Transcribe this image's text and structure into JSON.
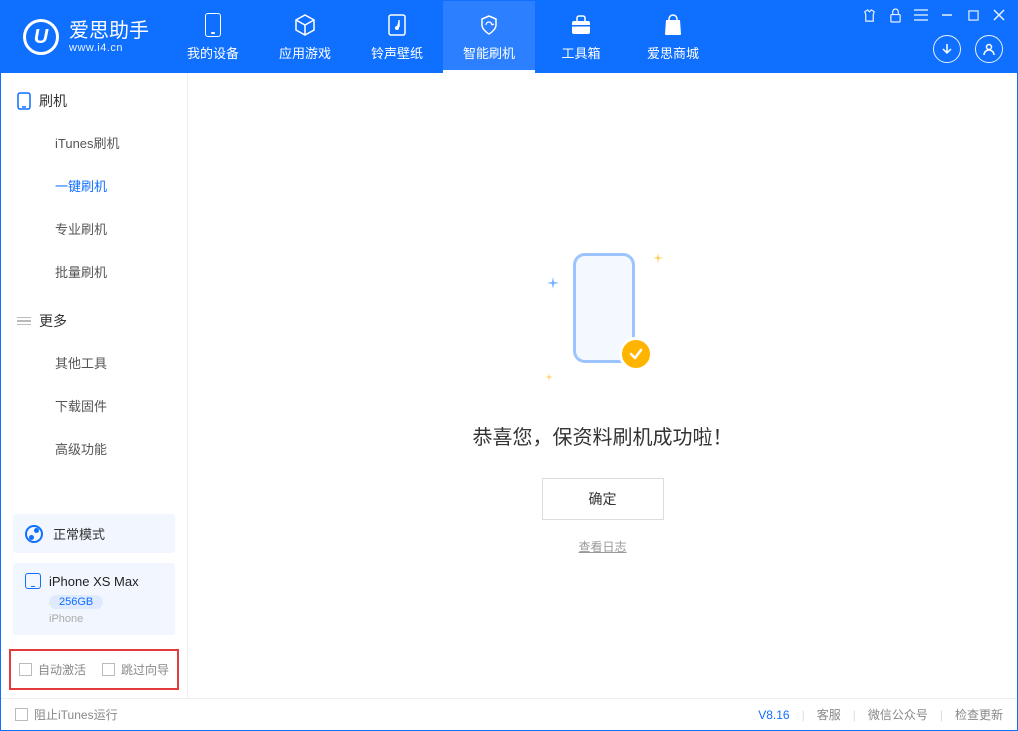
{
  "app": {
    "name": "爱思助手",
    "url": "www.i4.cn"
  },
  "nav": {
    "items": [
      {
        "label": "我的设备"
      },
      {
        "label": "应用游戏"
      },
      {
        "label": "铃声壁纸"
      },
      {
        "label": "智能刷机"
      },
      {
        "label": "工具箱"
      },
      {
        "label": "爱思商城"
      }
    ]
  },
  "sidebar": {
    "section1_title": "刷机",
    "section1_items": [
      "iTunes刷机",
      "一键刷机",
      "专业刷机",
      "批量刷机"
    ],
    "section2_title": "更多",
    "section2_items": [
      "其他工具",
      "下载固件",
      "高级功能"
    ]
  },
  "mode_label": "正常模式",
  "device": {
    "name": "iPhone XS Max",
    "storage": "256GB",
    "type": "iPhone"
  },
  "options": {
    "auto_activate": "自动激活",
    "skip_guide": "跳过向导"
  },
  "main": {
    "success_msg": "恭喜您，保资料刷机成功啦！",
    "ok_btn": "确定",
    "log_link": "查看日志"
  },
  "statusbar": {
    "block_itunes": "阻止iTunes运行",
    "version": "V8.16",
    "links": [
      "客服",
      "微信公众号",
      "检查更新"
    ]
  }
}
